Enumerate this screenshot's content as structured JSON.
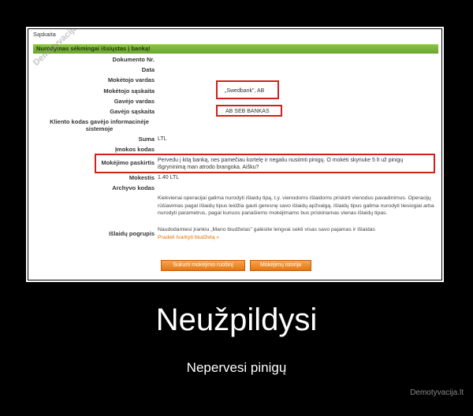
{
  "screenshot": {
    "window_title": "Sąskaita",
    "banner": "Nurodymas sėkmingai išsiųstas į banką!",
    "watermark": "Demotyvacija.lt",
    "fields": [
      {
        "label": "Dokumento Nr.",
        "value": ""
      },
      {
        "label": "Data",
        "value": ""
      },
      {
        "label": "Mokėtojo vardas",
        "value": ""
      },
      {
        "label": "Mokėtojo sąskaita",
        "value": "„Swedbank\", AB"
      },
      {
        "label": "Gavėjo vardas",
        "value": ""
      },
      {
        "label": "Gavėjo sąskaita",
        "value": "AB SEB BANKAS"
      },
      {
        "label": "Kliento kodas gavėjo informacinėje sistemoje",
        "value": ""
      },
      {
        "label": "Suma",
        "value": "LTL"
      },
      {
        "label": "Įmokos kodas",
        "value": ""
      },
      {
        "label": "Mokėjimo paskirtis",
        "value": "Pervedu į kitą banką, nes pamečiau kortelę ir negaliu nusiimti pinigų. O mokėti skyriuke 5 lt už pinigų išgryninimą man atrodo brangoka. Aišku?"
      },
      {
        "label": "Mokestis",
        "value": "1.40 LTL"
      },
      {
        "label": "Archyvo kodas",
        "value": ""
      },
      {
        "label": "Išlaidų pogrupis",
        "value": ""
      }
    ],
    "description": "Kiekvienai operacijai galima nurodyti išlaidų tipą, t.y. vienodoms išlaidoms priskirti vienodus pavadinimus. Operacijų rūšiavimas pagal išlaidų tipus leidžia gauti geresnę savo išlaidų apžvalgą. Išlaidų tipus galima nurodyti tiesiogiai arba nurodyti parametrus, pagal kuriuos panašiems mokėjimams bus priskiriamas vienas išlaidų tipas.",
    "budget_text": "Naudodamiesi įrankiu „Mano biudžetas\" galėsite lengvai sekti visas savo pajamas ir išlaidas",
    "budget_link": "Pradėti tvarkyti biudžetą »",
    "buttons": {
      "create_template": "Sukurti mokėjimo ruošinį",
      "history": "Mokėjimų istorija"
    }
  },
  "caption": {
    "title": "Neužpildysi",
    "subtitle": "Nepervesi pinigų"
  },
  "site_mark": "Demotyvacija.lt",
  "colors": {
    "highlight_red": "#d0211c",
    "banner_green": "#7ab33c",
    "button_orange": "#ee8a2a"
  }
}
